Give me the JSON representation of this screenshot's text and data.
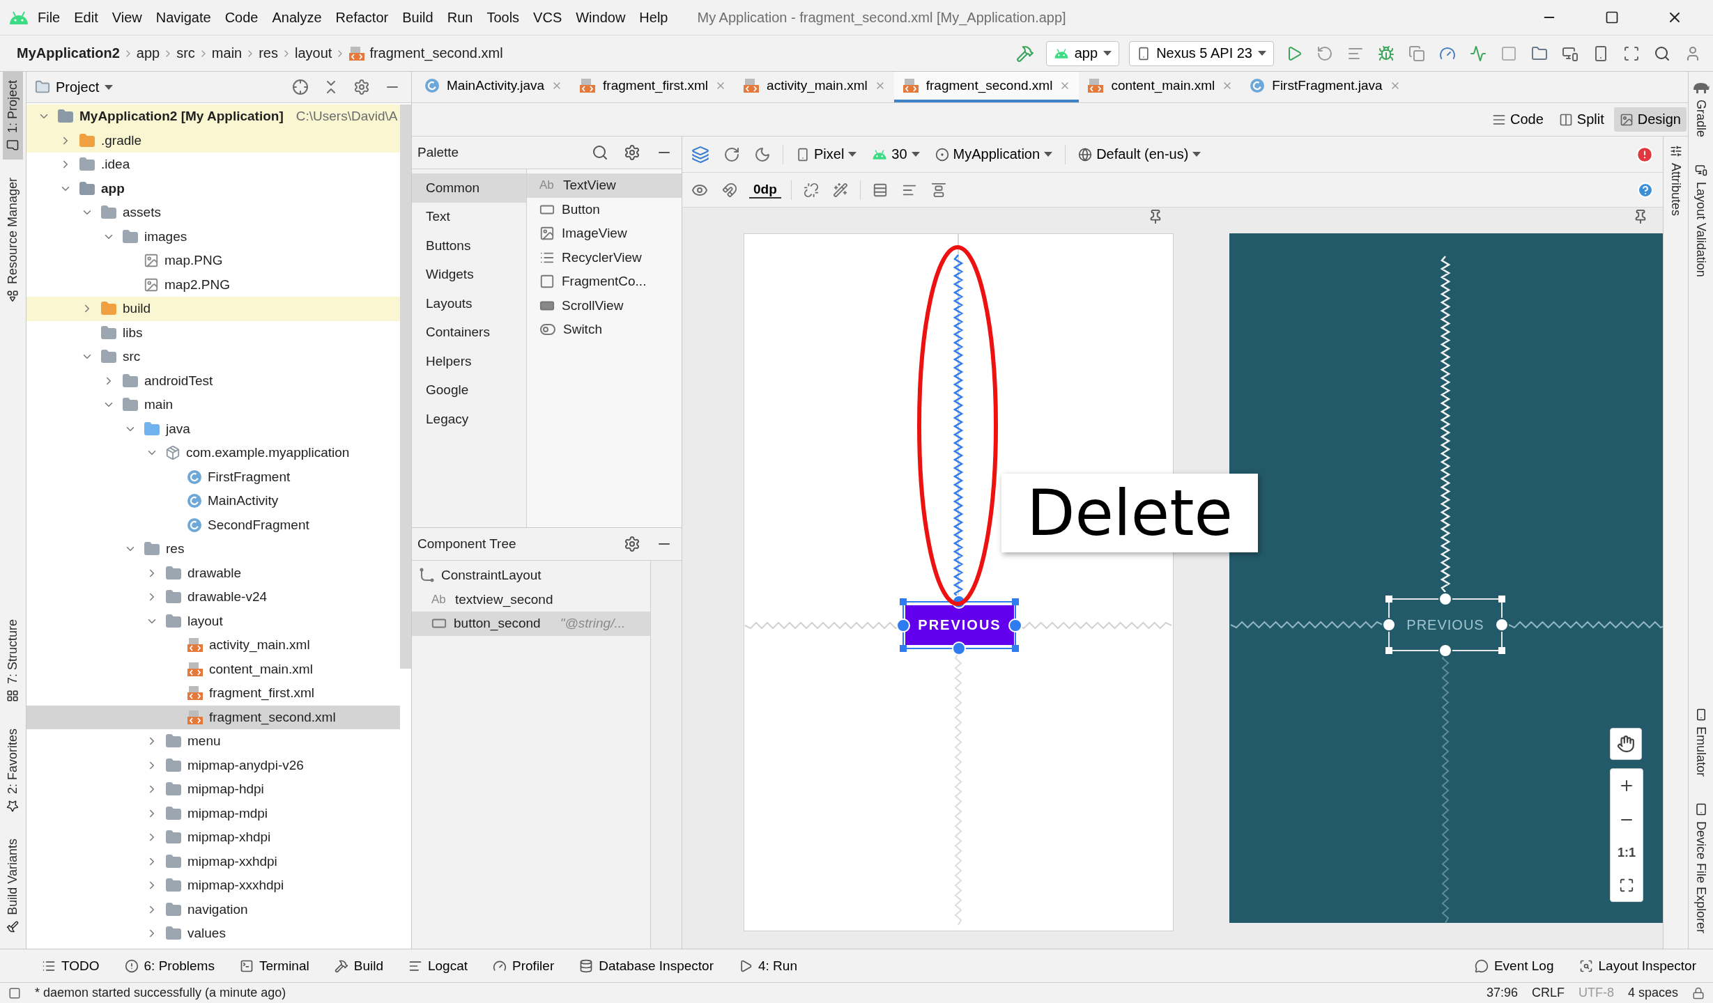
{
  "menu_bar": {
    "items": [
      "File",
      "Edit",
      "View",
      "Navigate",
      "Code",
      "Analyze",
      "Refactor",
      "Build",
      "Run",
      "Tools",
      "VCS",
      "Window",
      "Help"
    ],
    "title": "My Application - fragment_second.xml [My_Application.app]"
  },
  "breadcrumbs": [
    "MyApplication2",
    "app",
    "src",
    "main",
    "res",
    "layout",
    "fragment_second.xml"
  ],
  "run_toolbar": {
    "configuration": "app",
    "device": "Nexus 5 API 23"
  },
  "left_tool_strip": {
    "top": [
      {
        "label": "1: Project",
        "selected": true
      },
      {
        "label": "Resource Manager",
        "selected": false
      }
    ],
    "bottom": [
      {
        "label": "7: Structure",
        "selected": false
      },
      {
        "label": "2: Favorites",
        "selected": false
      },
      {
        "label": "Build Variants",
        "selected": false
      }
    ]
  },
  "project_panel": {
    "title": "Project",
    "tree": [
      {
        "label": "MyApplication2 [My Application]",
        "path": "C:\\Users\\David\\A",
        "kind": "module",
        "expanded": true,
        "highlighted": true,
        "selected": false,
        "children": [
          {
            "label": ".gradle",
            "kind": "folder-excluded",
            "expanded": false,
            "highlighted": true,
            "selected": false
          },
          {
            "label": ".idea",
            "kind": "folder",
            "expanded": false,
            "highlighted": false,
            "selected": false
          },
          {
            "label": "app",
            "kind": "module",
            "expanded": true,
            "highlighted": false,
            "selected": false,
            "children": [
              {
                "label": "assets",
                "kind": "folder",
                "expanded": true,
                "highlighted": false,
                "selected": false,
                "children": [
                  {
                    "label": "images",
                    "kind": "folder",
                    "expanded": true,
                    "highlighted": false,
                    "selected": false,
                    "children": [
                      {
                        "label": "map.PNG",
                        "kind": "image",
                        "highlighted": false,
                        "selected": false
                      },
                      {
                        "label": "map2.PNG",
                        "kind": "image",
                        "highlighted": false,
                        "selected": false
                      }
                    ]
                  }
                ]
              },
              {
                "label": "build",
                "kind": "folder-excluded",
                "expanded": false,
                "highlighted": true,
                "selected": false
              },
              {
                "label": "libs",
                "kind": "folder",
                "highlighted": false,
                "selected": false
              },
              {
                "label": "src",
                "kind": "folder",
                "expanded": true,
                "highlighted": false,
                "selected": false,
                "children": [
                  {
                    "label": "androidTest",
                    "kind": "folder",
                    "expanded": false,
                    "highlighted": false,
                    "selected": false
                  },
                  {
                    "label": "main",
                    "kind": "folder",
                    "expanded": true,
                    "highlighted": false,
                    "selected": false,
                    "children": [
                      {
                        "label": "java",
                        "kind": "folder-source",
                        "expanded": true,
                        "highlighted": false,
                        "selected": false,
                        "children": [
                          {
                            "label": "com.example.myapplication",
                            "kind": "package",
                            "expanded": true,
                            "highlighted": false,
                            "selected": false,
                            "children": [
                              {
                                "label": "FirstFragment",
                                "kind": "class",
                                "highlighted": false,
                                "selected": false
                              },
                              {
                                "label": "MainActivity",
                                "kind": "class",
                                "highlighted": false,
                                "selected": false
                              },
                              {
                                "label": "SecondFragment",
                                "kind": "class",
                                "highlighted": false,
                                "selected": false
                              }
                            ]
                          }
                        ]
                      },
                      {
                        "label": "res",
                        "kind": "folder",
                        "expanded": true,
                        "highlighted": false,
                        "selected": false,
                        "children": [
                          {
                            "label": "drawable",
                            "kind": "folder",
                            "expanded": false,
                            "highlighted": false,
                            "selected": false
                          },
                          {
                            "label": "drawable-v24",
                            "kind": "folder",
                            "expanded": false,
                            "highlighted": false,
                            "selected": false
                          },
                          {
                            "label": "layout",
                            "kind": "folder",
                            "expanded": true,
                            "highlighted": false,
                            "selected": false,
                            "children": [
                              {
                                "label": "activity_main.xml",
                                "kind": "xml",
                                "highlighted": false,
                                "selected": false
                              },
                              {
                                "label": "content_main.xml",
                                "kind": "xml",
                                "highlighted": false,
                                "selected": false
                              },
                              {
                                "label": "fragment_first.xml",
                                "kind": "xml",
                                "highlighted": false,
                                "selected": false
                              },
                              {
                                "label": "fragment_second.xml",
                                "kind": "xml",
                                "highlighted": false,
                                "selected": true
                              }
                            ]
                          },
                          {
                            "label": "menu",
                            "kind": "folder",
                            "expanded": false,
                            "highlighted": false,
                            "selected": false
                          },
                          {
                            "label": "mipmap-anydpi-v26",
                            "kind": "folder",
                            "expanded": false,
                            "highlighted": false,
                            "selected": false
                          },
                          {
                            "label": "mipmap-hdpi",
                            "kind": "folder",
                            "expanded": false,
                            "highlighted": false,
                            "selected": false
                          },
                          {
                            "label": "mipmap-mdpi",
                            "kind": "folder",
                            "expanded": false,
                            "highlighted": false,
                            "selected": false
                          },
                          {
                            "label": "mipmap-xhdpi",
                            "kind": "folder",
                            "expanded": false,
                            "highlighted": false,
                            "selected": false
                          },
                          {
                            "label": "mipmap-xxhdpi",
                            "kind": "folder",
                            "expanded": false,
                            "highlighted": false,
                            "selected": false
                          },
                          {
                            "label": "mipmap-xxxhdpi",
                            "kind": "folder",
                            "expanded": false,
                            "highlighted": false,
                            "selected": false
                          },
                          {
                            "label": "navigation",
                            "kind": "folder",
                            "expanded": false,
                            "highlighted": false,
                            "selected": false
                          },
                          {
                            "label": "values",
                            "kind": "folder",
                            "expanded": false,
                            "highlighted": false,
                            "selected": false
                          }
                        ]
                      }
                    ]
                  }
                ]
              }
            ]
          }
        ]
      }
    ]
  },
  "editor_tabs": [
    {
      "label": "MainActivity.java",
      "kind": "class",
      "selected": false
    },
    {
      "label": "fragment_first.xml",
      "kind": "xml",
      "selected": false
    },
    {
      "label": "activity_main.xml",
      "kind": "xml",
      "selected": false
    },
    {
      "label": "fragment_second.xml",
      "kind": "xml",
      "selected": true
    },
    {
      "label": "content_main.xml",
      "kind": "xml",
      "selected": false
    },
    {
      "label": "FirstFragment.java",
      "kind": "class",
      "selected": false
    }
  ],
  "view_modes": [
    {
      "label": "Code",
      "selected": false
    },
    {
      "label": "Split",
      "selected": false
    },
    {
      "label": "Design",
      "selected": true
    }
  ],
  "palette": {
    "title": "Palette",
    "categories": [
      {
        "label": "Common",
        "selected": true
      },
      {
        "label": "Text",
        "selected": false
      },
      {
        "label": "Buttons",
        "selected": false
      },
      {
        "label": "Widgets",
        "selected": false
      },
      {
        "label": "Layouts",
        "selected": false
      },
      {
        "label": "Containers",
        "selected": false
      },
      {
        "label": "Helpers",
        "selected": false
      },
      {
        "label": "Google",
        "selected": false
      },
      {
        "label": "Legacy",
        "selected": false
      }
    ],
    "widgets": [
      {
        "label": "TextView",
        "kind": "text",
        "glyph": "Ab",
        "selected": true
      },
      {
        "label": "Button",
        "kind": "button",
        "selected": false
      },
      {
        "label": "ImageView",
        "kind": "image",
        "selected": false
      },
      {
        "label": "RecyclerView",
        "kind": "list",
        "selected": false
      },
      {
        "label": "FragmentCo...",
        "kind": "fragment",
        "selected": false
      },
      {
        "label": "ScrollView",
        "kind": "scroll",
        "selected": false
      },
      {
        "label": "Switch",
        "kind": "switch",
        "selected": false
      }
    ]
  },
  "component_tree": {
    "title": "Component Tree",
    "items": [
      {
        "label": "ConstraintLayout",
        "kind": "layout",
        "selected": false,
        "children": [
          {
            "label": "textview_second",
            "kind": "text",
            "glyph": "Ab",
            "selected": false
          },
          {
            "label": "button_second",
            "kind": "button",
            "hint": "\"@string/...",
            "selected": true
          }
        ]
      }
    ]
  },
  "design_toolbar": {
    "device": "Pixel",
    "api": "30",
    "theme": "MyApplication",
    "locale": "Default (en-us)",
    "default_margin": "0dp"
  },
  "canvas": {
    "design_button": "PREVIOUS",
    "blueprint_button": "PREVIOUS",
    "annotation": "Delete"
  },
  "zoom_controls": {
    "reset": "1:1"
  },
  "attributes_strip": "Attributes",
  "right_tool_strip": {
    "top": [
      "Gradle",
      "Layout Validation"
    ],
    "bottom": [
      "Emulator",
      "Device File Explorer"
    ]
  },
  "bottom_tools": {
    "left": [
      "TODO",
      "6: Problems",
      "Terminal",
      "Build",
      "Logcat",
      "Profiler",
      "Database Inspector",
      "4: Run"
    ],
    "right": [
      "Event Log",
      "Layout Inspector"
    ]
  },
  "status_bar": {
    "message": "* daemon started successfully (a minute ago)",
    "items": [
      {
        "label": "37:96",
        "disabled": false
      },
      {
        "label": "CRLF",
        "disabled": false
      },
      {
        "label": "UTF-8",
        "disabled": true
      },
      {
        "label": "4 spaces",
        "disabled": false
      }
    ]
  }
}
